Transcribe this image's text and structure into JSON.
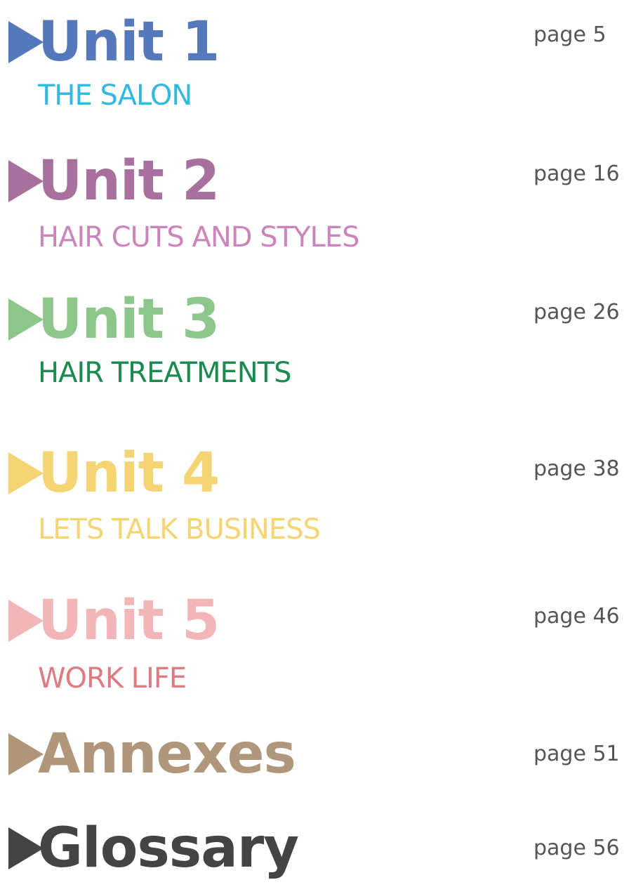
{
  "entries": [
    {
      "title": "Unit 1",
      "subtitle": "THE SALON",
      "page": "page 5",
      "title_color": "#5577bb",
      "subtitle_color": "#33b8e0"
    },
    {
      "title": "Unit 2",
      "subtitle": "HAIR CUTS AND STYLES",
      "page": "page 16",
      "title_color": "#a8709c",
      "subtitle_color": "#cc84bc"
    },
    {
      "title": "Unit 3",
      "subtitle": "HAIR TREATMENTS",
      "page": "page 26",
      "title_color": "#8cc68a",
      "subtitle_color": "#1a8a4e"
    },
    {
      "title": "Unit 4",
      "subtitle": "LETS TALK BUSINESS",
      "page": "page 38",
      "title_color": "#f5d473",
      "subtitle_color": "#f5d473"
    },
    {
      "title": "Unit 5",
      "subtitle": "WORK LIFE",
      "page": "page 46",
      "title_color": "#f3b6b8",
      "subtitle_color": "#e07a82"
    },
    {
      "title": "Annexes",
      "subtitle": "",
      "page": "page 51",
      "title_color": "#b0967a",
      "subtitle_color": "#b0967a"
    },
    {
      "title": "Glossary",
      "subtitle": "",
      "page": "page 56",
      "title_color": "#444444",
      "subtitle_color": "#444444"
    }
  ]
}
